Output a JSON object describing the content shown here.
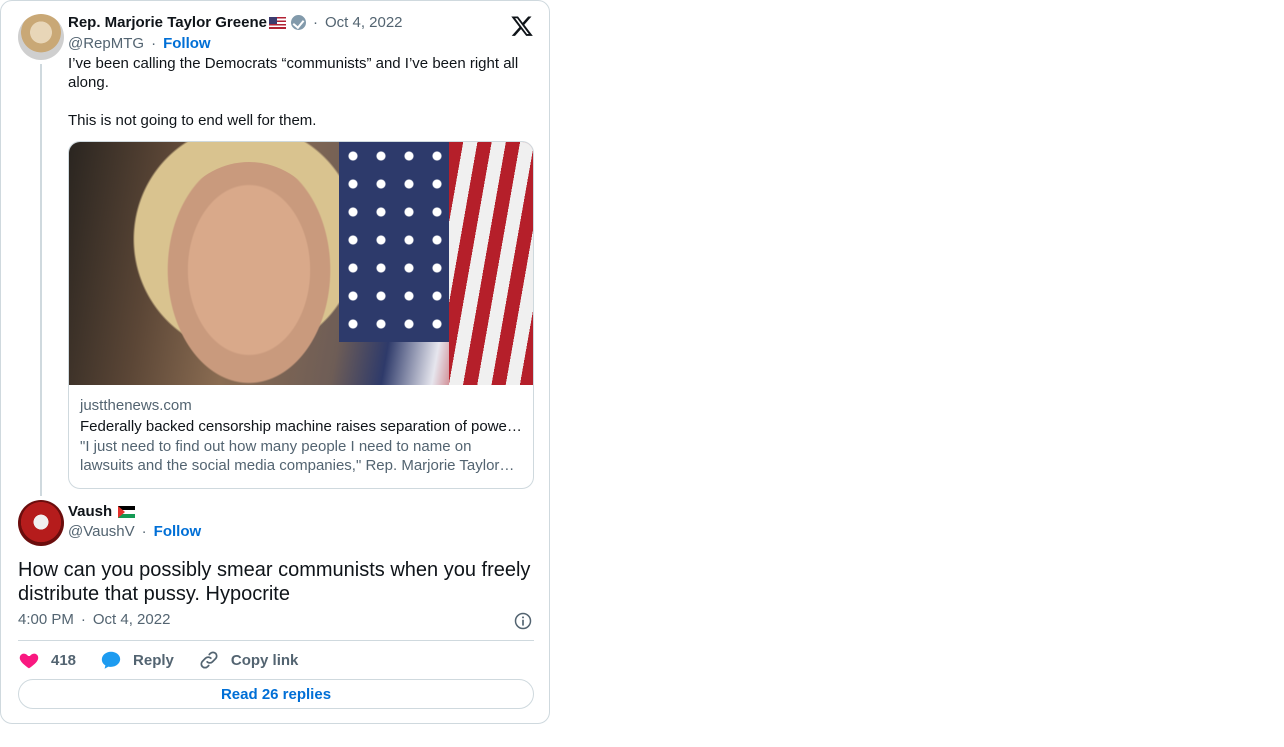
{
  "quoted_tweet": {
    "author_name": "Rep. Marjorie Taylor Greene",
    "handle": "@RepMTG",
    "date": "Oct 4, 2022",
    "follow_label": "Follow",
    "text_line1": "I’ve been calling the Democrats “communists” and I’ve been right all along.",
    "text_line2": "This is not going to end well for them.",
    "link_card": {
      "domain": "justthenews.com",
      "title": "Federally backed censorship machine raises separation of powers,...",
      "description": "\"I just need to find out how many people I need to name on lawsuits and the social media companies,\" Rep. Marjorie Taylor Greene says..."
    }
  },
  "tweet": {
    "author_name": "Vaush",
    "handle": "@VaushV",
    "follow_label": "Follow",
    "text": "How can you possibly smear communists when you freely distribute that pussy. Hypocrite",
    "time": "4:00 PM",
    "date": "Oct 4, 2022"
  },
  "actions": {
    "like_count": "418",
    "reply_label": "Reply",
    "copy_label": "Copy link"
  },
  "read_replies_label": "Read 26 replies",
  "icons": [
    "x-logo-icon",
    "verified-badge-icon",
    "us-flag-icon",
    "palestine-flag-icon",
    "heart-icon",
    "reply-bubble-icon",
    "link-icon",
    "info-icon"
  ],
  "colors": {
    "accent_blue": "#006fd6",
    "like_pink": "#f91880",
    "reply_blue": "#1d9bf0",
    "muted": "#536471",
    "border": "#cfd9de"
  }
}
